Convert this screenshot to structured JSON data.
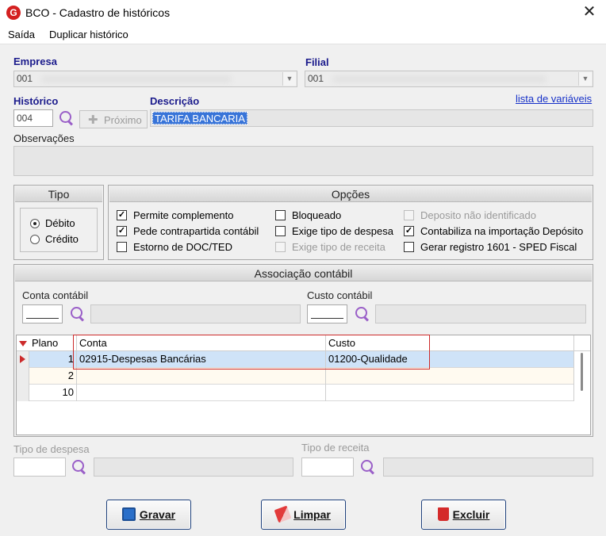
{
  "window": {
    "title": "BCO - Cadastro de históricos",
    "close_glyph": "✕",
    "logo_letter": "G"
  },
  "menu": {
    "items": [
      "Saída",
      "Duplicar histórico"
    ]
  },
  "empresa": {
    "label": "Empresa",
    "value": "001"
  },
  "filial": {
    "label": "Filial",
    "value": "001"
  },
  "historico": {
    "label": "Histórico",
    "value": "004",
    "next_button": "Próximo"
  },
  "descricao": {
    "label": "Descrição",
    "value": "TARIFA BANCARIA"
  },
  "variables_link": "lista de variáveis",
  "observacoes": {
    "label": "Observações",
    "value": ""
  },
  "tipo": {
    "title": "Tipo",
    "options": [
      {
        "label": "Débito",
        "selected": true
      },
      {
        "label": "Crédito",
        "selected": false
      }
    ]
  },
  "opcoes": {
    "title": "Opções",
    "items": [
      {
        "label": "Permite complemento",
        "checked": true,
        "enabled": true
      },
      {
        "label": "Pede contrapartida contábil",
        "checked": true,
        "enabled": true
      },
      {
        "label": "Estorno de DOC/TED",
        "checked": false,
        "enabled": true
      },
      {
        "label": "Bloqueado",
        "checked": false,
        "enabled": true
      },
      {
        "label": "Exige tipo de despesa",
        "checked": false,
        "enabled": true
      },
      {
        "label": "Exige tipo de receita",
        "checked": false,
        "enabled": false
      },
      {
        "label": "Deposito não identificado",
        "checked": false,
        "enabled": false
      },
      {
        "label": "Contabiliza na importação Depósito",
        "checked": true,
        "enabled": true
      },
      {
        "label": "Gerar registro 1601 - SPED Fiscal",
        "checked": false,
        "enabled": true
      }
    ]
  },
  "associacao": {
    "title": "Associação contábil",
    "conta_label": "Conta contábil",
    "custo_label": "Custo contábil",
    "columns": [
      "Plano",
      "Conta",
      "Custo"
    ],
    "rows": [
      {
        "plano": "1",
        "conta": "02915-Despesas Bancárias",
        "custo": "01200-Qualidade"
      },
      {
        "plano": "2",
        "conta": "",
        "custo": ""
      },
      {
        "plano": "10",
        "conta": "",
        "custo": ""
      }
    ]
  },
  "tipo_despesa": {
    "label": "Tipo de despesa"
  },
  "tipo_receita": {
    "label": "Tipo de receita"
  },
  "buttons": {
    "save": "Gravar",
    "clear": "Limpar",
    "delete": "Excluir"
  },
  "colors": {
    "label_blue": "#1b1b8c",
    "highlight_red": "#cc2a2a",
    "selected_row": "#cfe3f8",
    "link": "#1530c8"
  }
}
